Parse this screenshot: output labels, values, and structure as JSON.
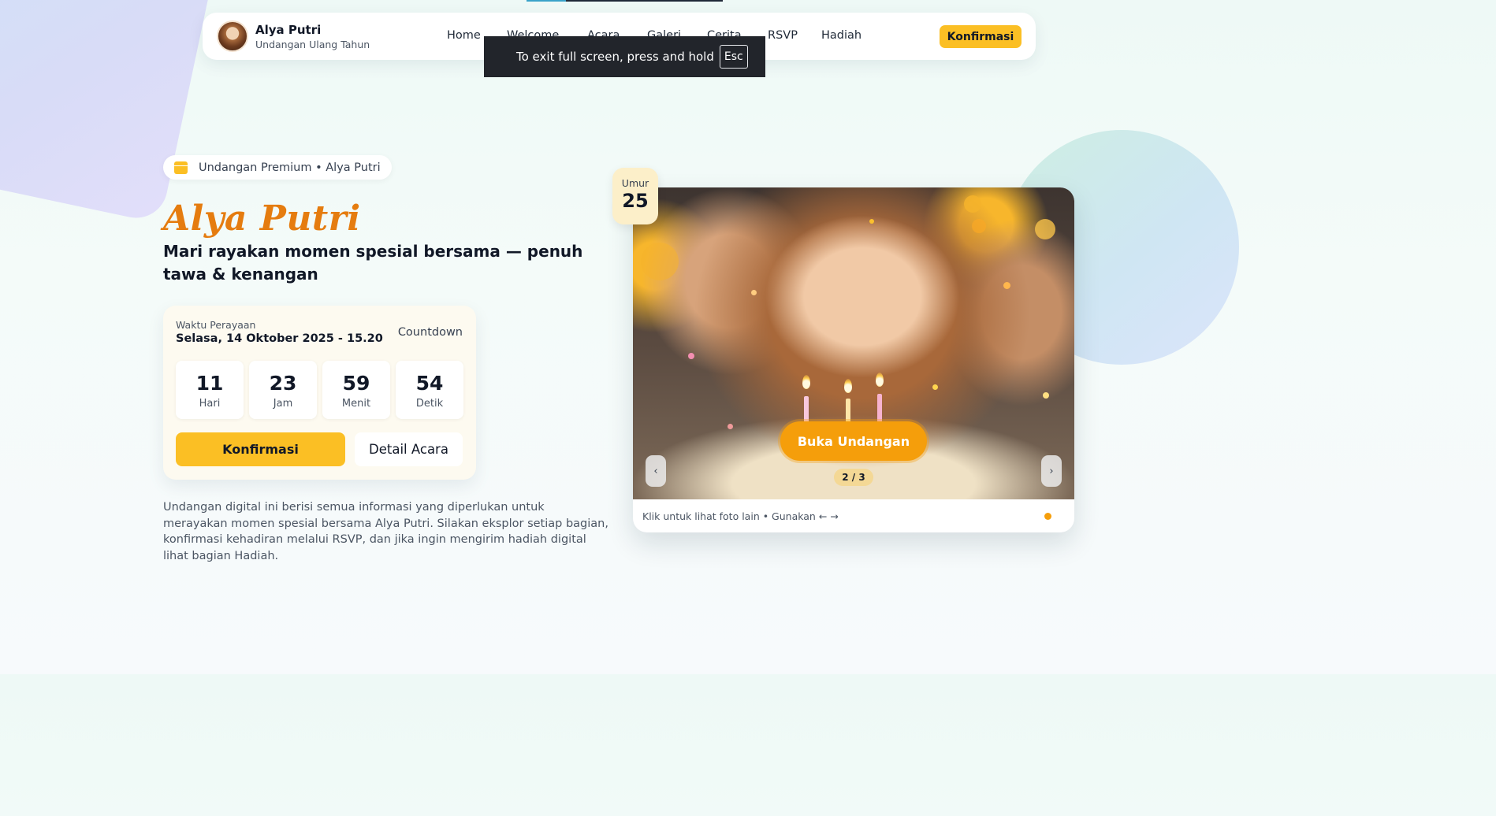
{
  "brand": {
    "name": "Alya Putri",
    "subtitle": "Undangan Ulang Tahun"
  },
  "nav": {
    "links": [
      "Home",
      "Welcome",
      "Acara",
      "Galeri",
      "Cerita",
      "RSVP",
      "Hadiah"
    ],
    "cta_label": "Konfirmasi"
  },
  "fullscreen_toast": {
    "text": "To exit full screen, press and hold",
    "key": "Esc"
  },
  "hero": {
    "pill_text": "Undangan Premium • Alya Putri",
    "pill_icon": "calendar-icon",
    "title": "Alya Putri",
    "subtitle": "Mari rayakan momen spesial bersama — penuh tawa & kenangan",
    "description": "Undangan digital ini berisi semua informasi yang diperlukan untuk merayakan momen spesial bersama Alya Putri. Silakan eksplor setiap bagian, konfirmasi kehadiran melalui RSVP, dan jika ingin mengirim hadiah digital lihat bagian Hadiah."
  },
  "countdown": {
    "label": "Waktu Perayaan",
    "datetime": "Selasa, 14 Oktober 2025 - 15.20",
    "title": "Countdown",
    "units": [
      {
        "value": "11",
        "unit": "Hari"
      },
      {
        "value": "23",
        "unit": "Jam"
      },
      {
        "value": "59",
        "unit": "Menit"
      },
      {
        "value": "54",
        "unit": "Detik"
      }
    ],
    "primary_label": "Konfirmasi",
    "secondary_label": "Detail Acara"
  },
  "gallery": {
    "age_label": "Umur",
    "age_value": "25",
    "open_label": "Buka Undangan",
    "counter": "2 / 3",
    "prev_label": "‹",
    "next_label": "›",
    "hint": "Klik untuk lihat foto lain • Gunakan ← →"
  },
  "colors": {
    "accent": "#fbbf24",
    "title": "#e57c0f",
    "open_button": "#f59e0b"
  }
}
